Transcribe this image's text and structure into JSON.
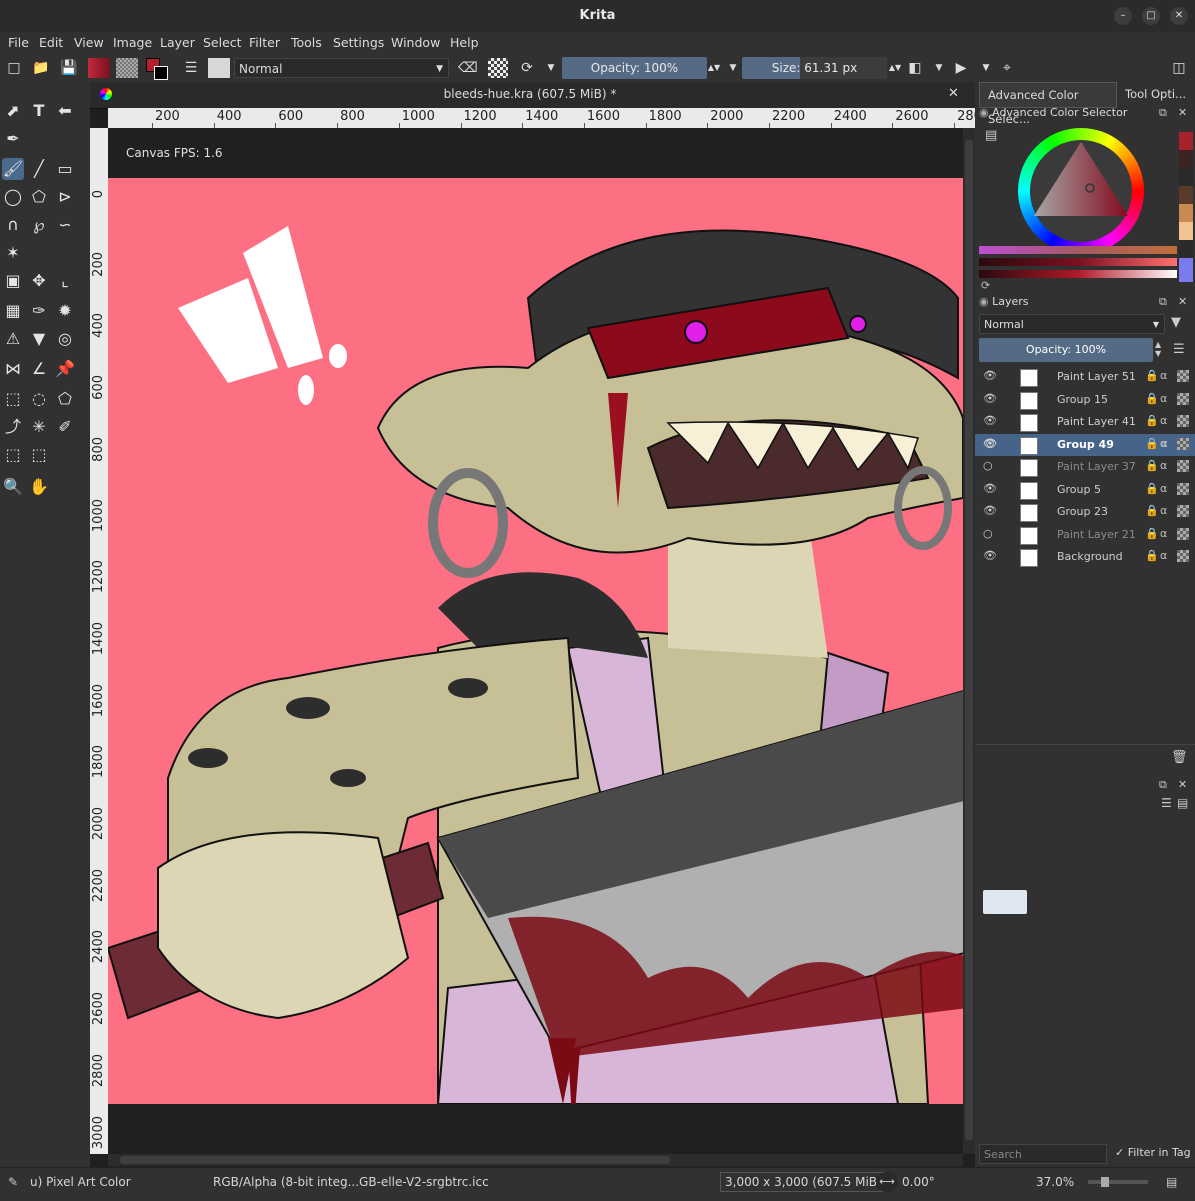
{
  "window": {
    "title": "Krita"
  },
  "menu": [
    "File",
    "Edit",
    "View",
    "Image",
    "Layer",
    "Select",
    "Filter",
    "Tools",
    "Settings",
    "Window",
    "Help"
  ],
  "toolbar": {
    "blend_mode": "Normal",
    "opacity": "Opacity: 100%",
    "size": "Size: 61.31 px"
  },
  "document": {
    "tab_title": "bleeds-hue.kra (607.5 MiB) *",
    "fps": "Canvas FPS: 1.6"
  },
  "rulers": {
    "horizontal": [
      "200",
      "400",
      "600",
      "800",
      "1000",
      "1200",
      "1400",
      "1600",
      "1800",
      "2000",
      "2200",
      "2400",
      "2600",
      "280"
    ],
    "vertical": [
      "0",
      "200",
      "400",
      "600",
      "800",
      "1000",
      "1200",
      "1400",
      "1600",
      "1800",
      "2000",
      "2200",
      "2400",
      "2600",
      "2800",
      "3000"
    ]
  },
  "dock": {
    "tabs": [
      "Advanced Color Selec...",
      "Tool Opti..."
    ],
    "color_selector_title": "Advanced Color Selector",
    "layers_title": "Layers",
    "layers_blend": "Normal",
    "layers_opacity": "Opacity:  100%",
    "layers": [
      {
        "name": "Paint Layer 51",
        "visible": true,
        "selected": false,
        "dim": false
      },
      {
        "name": "Group 15",
        "visible": true,
        "selected": false,
        "dim": false
      },
      {
        "name": "Paint Layer 41",
        "visible": true,
        "selected": false,
        "dim": false
      },
      {
        "name": "Group 49",
        "visible": true,
        "selected": true,
        "dim": false
      },
      {
        "name": "Paint Layer 37",
        "visible": false,
        "selected": false,
        "dim": true
      },
      {
        "name": "Group 5",
        "visible": true,
        "selected": false,
        "dim": false
      },
      {
        "name": "Group 23",
        "visible": true,
        "selected": false,
        "dim": false
      },
      {
        "name": "Paint Layer 21",
        "visible": false,
        "selected": false,
        "dim": true
      },
      {
        "name": "Background",
        "visible": true,
        "selected": false,
        "dim": false
      }
    ],
    "search_placeholder": "Search",
    "filter_in_tag": "Filter in Tag"
  },
  "status": {
    "brush": "u) Pixel Art Color",
    "color_profile": "RGB/Alpha (8-bit integ...GB-elle-V2-srgbtrc.icc",
    "dimensions": "3,000 x 3,000 (607.5 MiB)",
    "rotation": "0.00°",
    "zoom": "37.0%"
  },
  "colors": {
    "canvas_bg": "#fd6f83",
    "selection": "#46648a",
    "accent": "#556b85"
  }
}
